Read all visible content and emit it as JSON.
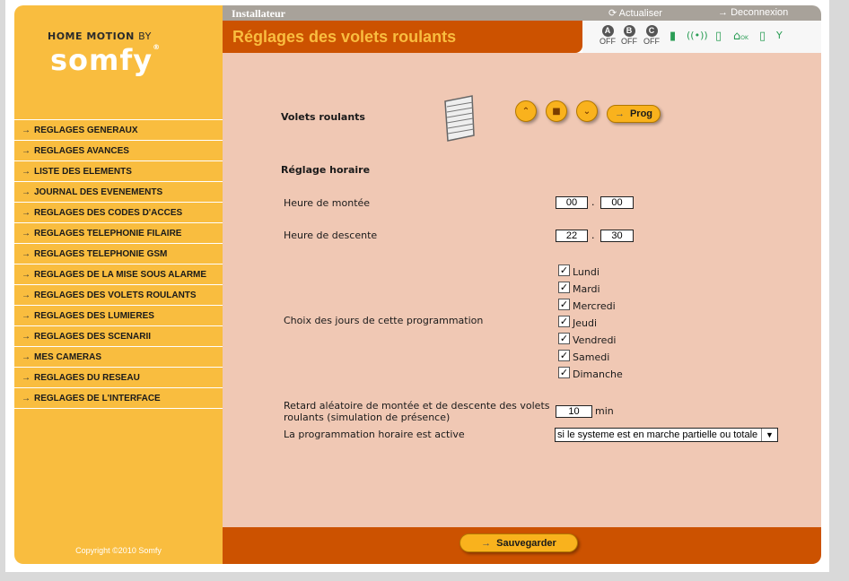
{
  "brand": {
    "name": "HOME MOTION",
    "by": "BY",
    "logo": "somfy"
  },
  "sidebar": {
    "items": [
      "REGLAGES GENERAUX",
      "REGLAGES AVANCES",
      "LISTE DES ELEMENTS",
      "JOURNAL DES EVENEMENTS",
      "REGLAGES DES CODES D'ACCES",
      "REGLAGES TELEPHONIE FILAIRE",
      "REGLAGES TELEPHONIE GSM",
      "REGLAGES DE LA MISE SOUS ALARME",
      "REGLAGES DES VOLETS ROULANTS",
      "REGLAGES DES LUMIERES",
      "REGLAGES DES SCENARII",
      "MES CAMERAS",
      "REGLAGES DU RESEAU",
      "REGLAGES DE L'INTERFACE"
    ],
    "copyright": "Copyright ©2010 Somfy"
  },
  "header": {
    "user": "Installateur",
    "refresh": "Actualiser",
    "logout": "Deconnexion",
    "title": "Réglages des volets roulants"
  },
  "status": {
    "zones": [
      {
        "letter": "A",
        "state": "OFF"
      },
      {
        "letter": "B",
        "state": "OFF"
      },
      {
        "letter": "C",
        "state": "OFF"
      }
    ],
    "icons": [
      "battery-icon",
      "wireless-signal-icon",
      "phone-icon",
      "home-ok-icon",
      "sensor-icon",
      "antenna-icon"
    ],
    "home_ok": "OK"
  },
  "shutters": {
    "label": "Volets roulants",
    "prog_label": "Prog"
  },
  "schedule": {
    "section_title": "Réglage horaire",
    "up_label": "Heure de montée",
    "up_hour": "00",
    "up_minute": "00",
    "down_label": "Heure de descente",
    "down_hour": "22",
    "down_minute": "30",
    "separator": ".",
    "days_label": "Choix des jours de cette programmation",
    "days": [
      {
        "name": "Lundi",
        "checked": true
      },
      {
        "name": "Mardi",
        "checked": true
      },
      {
        "name": "Mercredi",
        "checked": true
      },
      {
        "name": "Jeudi",
        "checked": true
      },
      {
        "name": "Vendredi",
        "checked": true
      },
      {
        "name": "Samedi",
        "checked": true
      },
      {
        "name": "Dimanche",
        "checked": true
      }
    ],
    "delay_label_1": "Retard aléatoire de montée et de descente des volets",
    "delay_label_2": "roulants (simulation de présence)",
    "delay_value": "10",
    "delay_unit": "min",
    "active_label": "La programmation horaire est active",
    "active_value": "si le systeme est en marche partielle ou totale"
  },
  "footer": {
    "save_label": "Sauvegarder"
  },
  "colors": {
    "sidebar": "#f9bd3f",
    "accent": "#cc5200",
    "content_bg": "#f0c8b4",
    "button": "#f9b21d"
  }
}
